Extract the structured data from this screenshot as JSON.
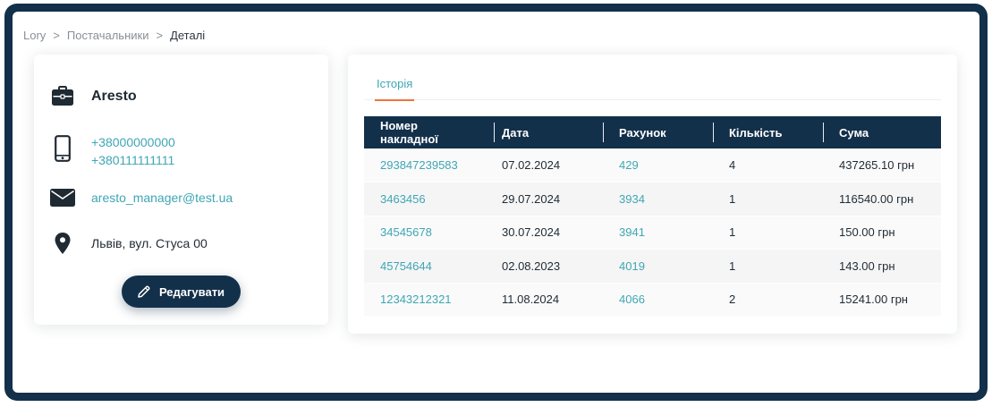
{
  "breadcrumb": {
    "items": [
      "Lory",
      "Постачальники"
    ],
    "separator": ">",
    "current": "Деталі"
  },
  "supplier": {
    "name": "Aresto",
    "phones": [
      "+38000000000",
      "+380111111111"
    ],
    "email": "aresto_manager@test.ua",
    "address": "Львів, вул. Стуса 00",
    "edit_label": "Редагувати"
  },
  "history": {
    "tab_label": "Історія",
    "columns": [
      "Номер накладної",
      "Дата",
      "Рахунок",
      "Кількість",
      "Сума"
    ],
    "rows": [
      {
        "invoice": "293847239583",
        "date": "07.02.2024",
        "account": "429",
        "quantity": "4",
        "sum": "437265.10 грн"
      },
      {
        "invoice": "3463456",
        "date": "29.07.2024",
        "account": "3934",
        "quantity": "1",
        "sum": "116540.00 грн"
      },
      {
        "invoice": "34545678",
        "date": "30.07.2024",
        "account": "3941",
        "quantity": "1",
        "sum": "150.00 грн"
      },
      {
        "invoice": "45754644",
        "date": "02.08.2023",
        "account": "4019",
        "quantity": "1",
        "sum": "143.00 грн"
      },
      {
        "invoice": "12343212321",
        "date": "11.08.2024",
        "account": "4066",
        "quantity": "2",
        "sum": "15241.00 грн"
      }
    ]
  },
  "icons": {
    "name": "briefcase-icon",
    "phone": "phone-icon",
    "email": "envelope-icon",
    "address": "location-pin-icon",
    "edit": "pencil-icon"
  },
  "colors": {
    "primary": "#13304b",
    "link": "#3fa6b5",
    "tab_underline": "#f0733b"
  }
}
